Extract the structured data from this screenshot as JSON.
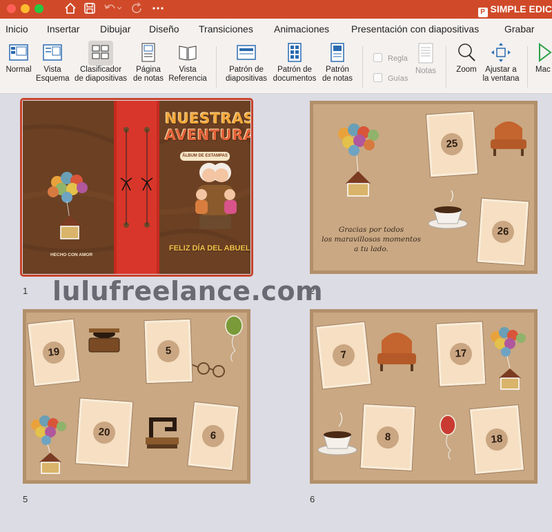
{
  "app": {
    "title": "SIMPLE EDIC",
    "badge": "P"
  },
  "titlebar": {
    "home_icon": "home-icon",
    "save_icon": "save-icon",
    "undo_icon": "undo-icon",
    "redo_icon": "redo-icon",
    "more_icon": "more-icon"
  },
  "tabs": [
    "Inicio",
    "Insertar",
    "Dibujar",
    "Diseño",
    "Transiciones",
    "Animaciones",
    "Presentación con diapositivas",
    "Grabar"
  ],
  "ribbon": {
    "normal": "Normal",
    "outline": [
      "Vista",
      "Esquema"
    ],
    "sorter": [
      "Clasificador",
      "de diapositivas"
    ],
    "notes_page": [
      "Página",
      "de notas"
    ],
    "reading": [
      "Vista",
      "Referencia"
    ],
    "slide_master": [
      "Patrón de",
      "diapositivas"
    ],
    "handout_master": [
      "Patrón de",
      "documentos"
    ],
    "notes_master": [
      "Patrón",
      "de notas"
    ],
    "ruler": "Regla",
    "guides": "Guías",
    "notes": "Notas",
    "zoom": "Zoom",
    "fit": [
      "Ajustar a",
      "la ventana"
    ],
    "macros": "Mac"
  },
  "slides": {
    "s1": {
      "number": "1",
      "title_line1": "NUESTRAS",
      "title_line2": "AVENTURAS",
      "subtitle": "ÁLBUM DE ESTAMPAS",
      "made_with": "HECHO CON AMOR",
      "footer": "FELIZ DÍA DEL ABUELO"
    },
    "s2": {
      "number": "2",
      "message": [
        "Gracias por todos",
        "los maravillosos momentos",
        "a tu lado."
      ],
      "frames": [
        "25",
        "26"
      ]
    },
    "s5": {
      "number": "5",
      "frames": [
        "19",
        "5",
        "20",
        "6"
      ]
    },
    "s6": {
      "number": "6",
      "frames": [
        "7",
        "17",
        "8",
        "18"
      ]
    }
  },
  "watermark": "lulufreelance.com",
  "colors": {
    "titlebar": "#d04a29",
    "ribbon": "#f4f1ef",
    "leather": "#6f4325",
    "parchment": "#c4a27d",
    "selection": "#c8432b"
  }
}
